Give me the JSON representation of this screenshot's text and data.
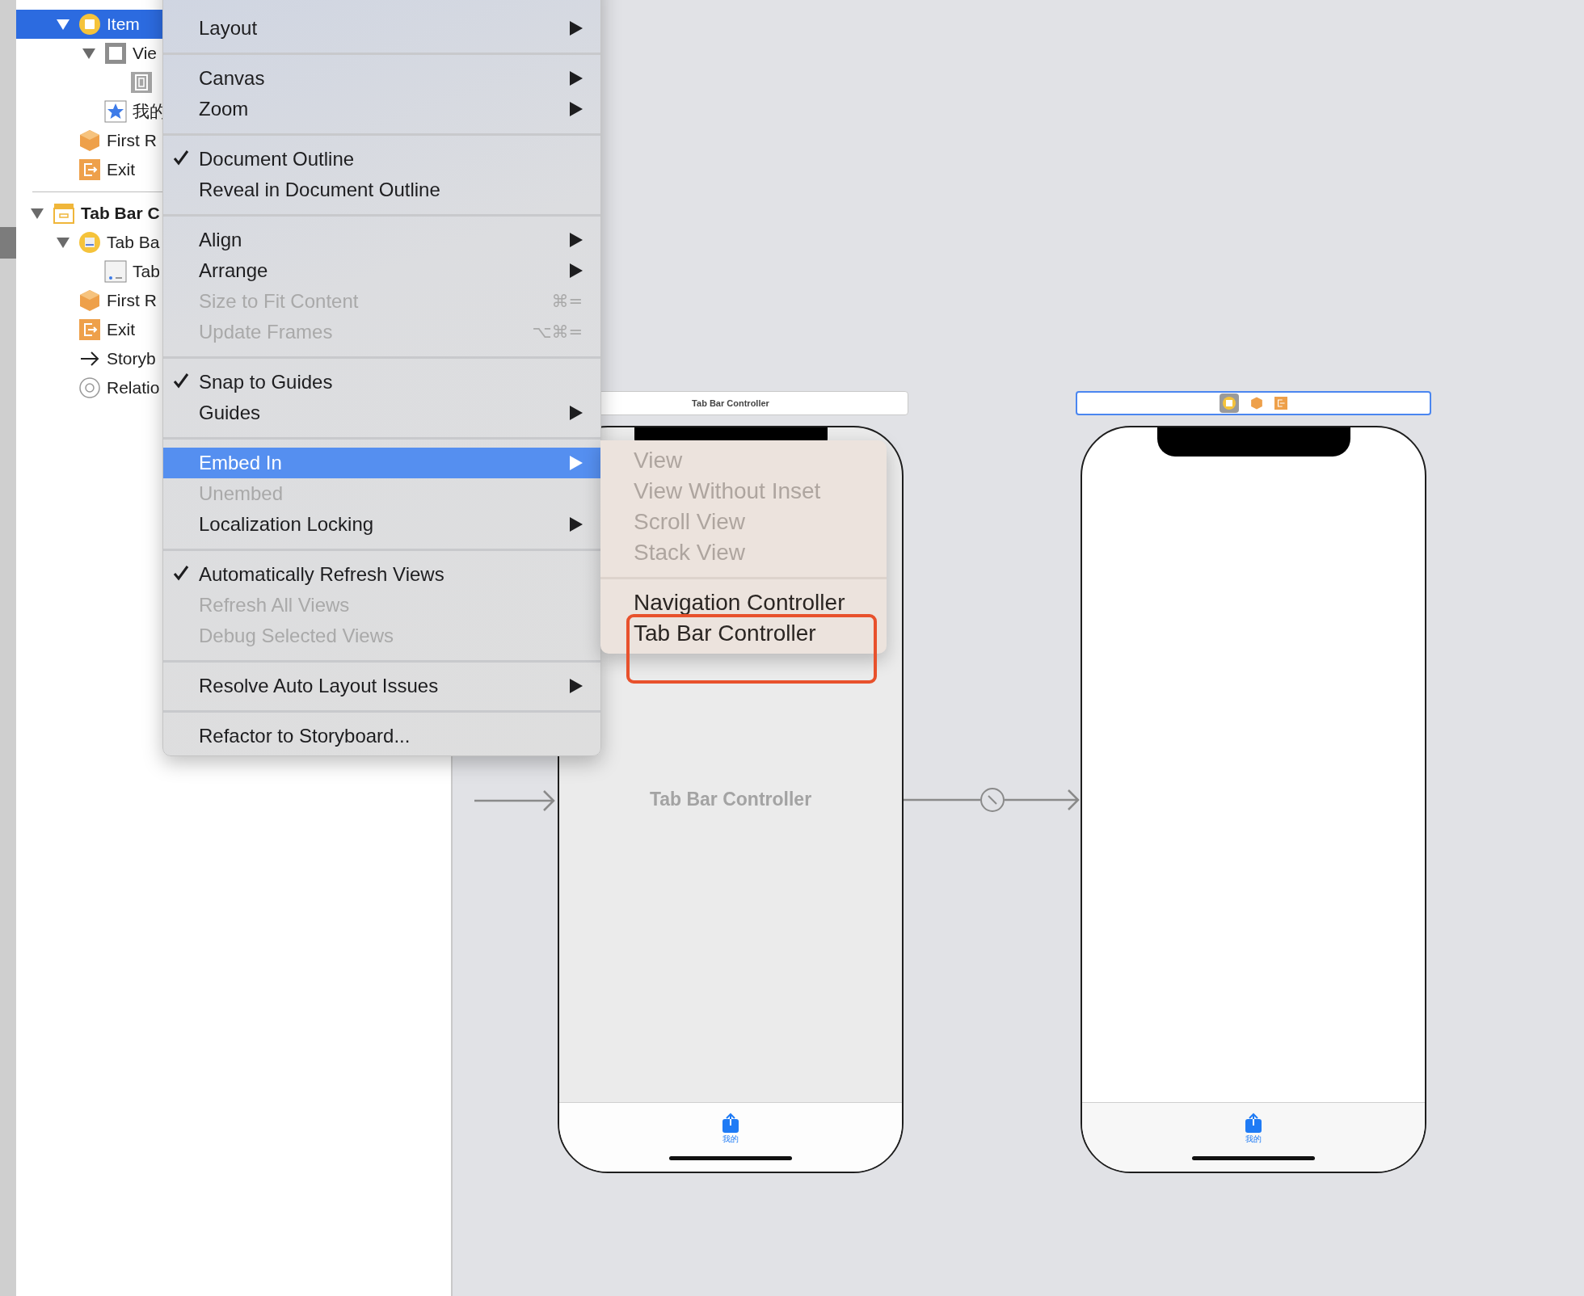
{
  "outline": {
    "sections": [
      {
        "children": [
          {
            "label": "Item",
            "kind": "scene",
            "selected": true,
            "expanded": true,
            "children": [
              {
                "label": "Vie",
                "kind": "view",
                "selected": false,
                "expanded": true,
                "children": [
                  {
                    "kind": "safe-area",
                    "selected": false
                  }
                ]
              },
              {
                "label": "我的",
                "kind": "tab-item",
                "selected": false
              }
            ]
          },
          {
            "label": "First R",
            "kind": "first-responder",
            "selected": false
          },
          {
            "label": "Exit",
            "kind": "exit",
            "selected": false
          }
        ]
      },
      {
        "label": "Tab Bar C",
        "kind": "storyboard-scene",
        "bold": true,
        "selected": false,
        "expanded": true,
        "children": [
          {
            "label": "Tab Ba",
            "kind": "tab-controller",
            "selected": false,
            "expanded": true,
            "children": [
              {
                "label": "Tab",
                "kind": "tab-bar",
                "selected": false
              }
            ]
          },
          {
            "label": "First R",
            "kind": "first-responder",
            "selected": false
          },
          {
            "label": "Exit",
            "kind": "exit",
            "selected": false
          },
          {
            "label": "Storyb",
            "kind": "arrow",
            "selected": false
          },
          {
            "label": "Relatio",
            "kind": "relationship",
            "selected": false
          }
        ]
      }
    ]
  },
  "menu": {
    "items": [
      {
        "kind": "item",
        "label": "Layout",
        "checked": false,
        "disabled": false,
        "selected": false,
        "submenu": true
      },
      {
        "kind": "separator"
      },
      {
        "kind": "item",
        "label": "Canvas",
        "checked": false,
        "disabled": false,
        "selected": false,
        "submenu": true
      },
      {
        "kind": "item",
        "label": "Zoom",
        "checked": false,
        "disabled": false,
        "selected": false,
        "submenu": true
      },
      {
        "kind": "separator"
      },
      {
        "kind": "item",
        "label": "Document Outline",
        "checked": true,
        "disabled": false,
        "selected": false,
        "submenu": false
      },
      {
        "kind": "item",
        "label": "Reveal in Document Outline",
        "checked": false,
        "disabled": false,
        "selected": false,
        "submenu": false
      },
      {
        "kind": "separator"
      },
      {
        "kind": "item",
        "label": "Align",
        "checked": false,
        "disabled": false,
        "selected": false,
        "submenu": true
      },
      {
        "kind": "item",
        "label": "Arrange",
        "checked": false,
        "disabled": false,
        "selected": false,
        "submenu": true
      },
      {
        "kind": "item",
        "label": "Size to Fit Content",
        "shortcut": "⌘=",
        "checked": false,
        "disabled": true,
        "selected": false,
        "submenu": false
      },
      {
        "kind": "item",
        "label": "Update Frames",
        "shortcut": "⌥⌘=",
        "checked": false,
        "disabled": true,
        "selected": false,
        "submenu": false
      },
      {
        "kind": "separator"
      },
      {
        "kind": "item",
        "label": "Snap to Guides",
        "checked": true,
        "disabled": false,
        "selected": false,
        "submenu": false
      },
      {
        "kind": "item",
        "label": "Guides",
        "checked": false,
        "disabled": false,
        "selected": false,
        "submenu": true
      },
      {
        "kind": "separator"
      },
      {
        "kind": "item",
        "label": "Embed In",
        "checked": false,
        "disabled": false,
        "selected": true,
        "submenu": true
      },
      {
        "kind": "item",
        "label": "Unembed",
        "checked": false,
        "disabled": true,
        "selected": false,
        "submenu": false
      },
      {
        "kind": "item",
        "label": "Localization Locking",
        "checked": false,
        "disabled": false,
        "selected": false,
        "submenu": true
      },
      {
        "kind": "separator"
      },
      {
        "kind": "item",
        "label": "Automatically Refresh Views",
        "checked": true,
        "disabled": false,
        "selected": false,
        "submenu": false
      },
      {
        "kind": "item",
        "label": "Refresh All Views",
        "checked": false,
        "disabled": true,
        "selected": false,
        "submenu": false
      },
      {
        "kind": "item",
        "label": "Debug Selected Views",
        "checked": false,
        "disabled": true,
        "selected": false,
        "submenu": false
      },
      {
        "kind": "separator"
      },
      {
        "kind": "item",
        "label": "Resolve Auto Layout Issues",
        "checked": false,
        "disabled": false,
        "selected": false,
        "submenu": true
      },
      {
        "kind": "separator"
      },
      {
        "kind": "item",
        "label": "Refactor to Storyboard...",
        "checked": false,
        "disabled": false,
        "selected": false,
        "submenu": false
      }
    ]
  },
  "submenu": {
    "items": [
      {
        "kind": "item",
        "label": "View",
        "disabled": true
      },
      {
        "kind": "item",
        "label": "View Without Inset",
        "disabled": true
      },
      {
        "kind": "item",
        "label": "Scroll View",
        "disabled": true
      },
      {
        "kind": "item",
        "label": "Stack View",
        "disabled": true
      },
      {
        "kind": "separator"
      },
      {
        "kind": "item",
        "label": "Navigation Controller",
        "disabled": false
      },
      {
        "kind": "item",
        "label": "Tab Bar Controller",
        "disabled": false,
        "highlighted": true
      }
    ]
  },
  "scenes": [
    {
      "title": "Tab Bar Controller",
      "selected": false,
      "body_label": "Tab Bar Controller",
      "tab_label": "我的"
    },
    {
      "selected": true,
      "tab_label": "我的"
    }
  ]
}
